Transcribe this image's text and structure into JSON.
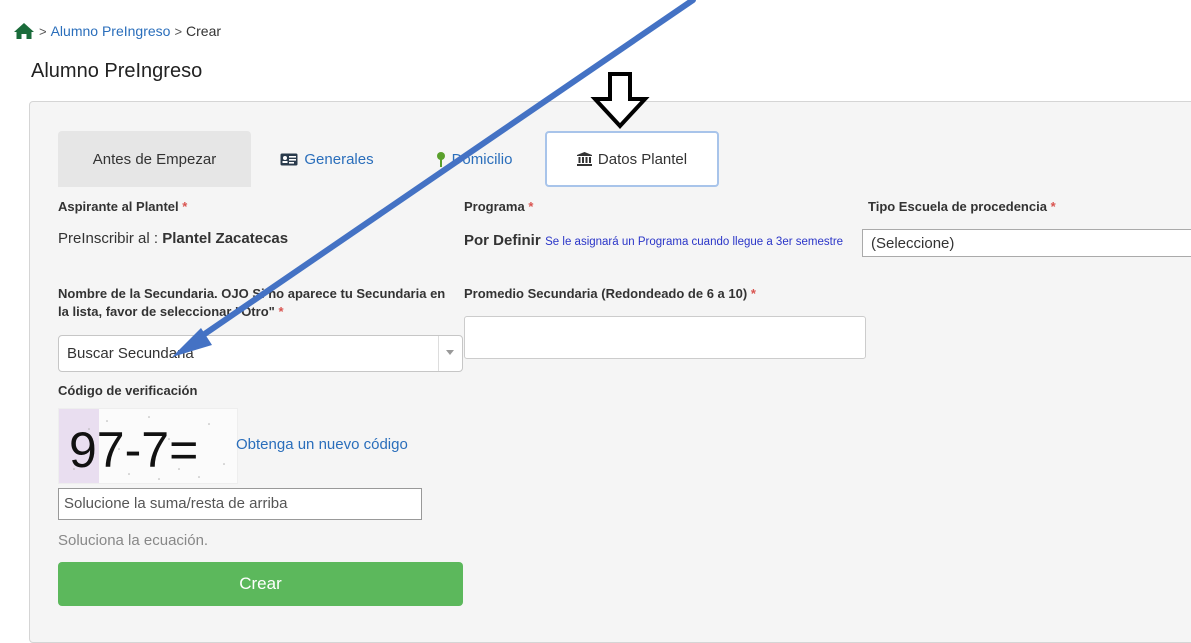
{
  "breadcrumb": {
    "items": [
      "Alumno PreIngreso",
      "Crear"
    ],
    "separator": ">"
  },
  "page_title": "Alumno PreIngreso",
  "tabs": [
    {
      "label": "Antes de Empezar",
      "icon": ""
    },
    {
      "label": "Generales",
      "icon": "id-card-icon"
    },
    {
      "label": "Domicilio",
      "icon": "map-pin-icon"
    },
    {
      "label": "Datos Plantel",
      "icon": "bank-icon"
    }
  ],
  "fields": {
    "aspirante_label": "Aspirante al Plantel",
    "aspirante_prefix": "PreInscribir al :",
    "aspirante_value": "Plantel Zacatecas",
    "programa_label": "Programa",
    "programa_value": "Por Definir",
    "programa_note": "Se le asignará un Programa cuando llegue a 3er semestre",
    "tipo_escuela_label": "Tipo Escuela de procedencia",
    "tipo_escuela_value": "(Seleccione)",
    "secundaria_label": "Nombre de la Secundaria. OJO Si no aparece tu Secundaria en la lista, favor de seleccionar \"Otro\"",
    "secundaria_placeholder": "Buscar Secundaria",
    "promedio_label": "Promedio Secundaria (Redondeado de 6 a 10)",
    "codigo_label": "Código de verificación",
    "captcha_text": "97-7=",
    "captcha_refresh": "Obtenga un nuevo código",
    "captcha_placeholder": "Solucione la suma/resta de arriba",
    "captcha_help": "Soluciona la ecuación.",
    "required_mark": "*"
  },
  "submit_label": "Crear",
  "colors": {
    "primary_link": "#2a6ebb",
    "submit": "#5cb85c",
    "annotation_arrow": "#4472c4"
  }
}
